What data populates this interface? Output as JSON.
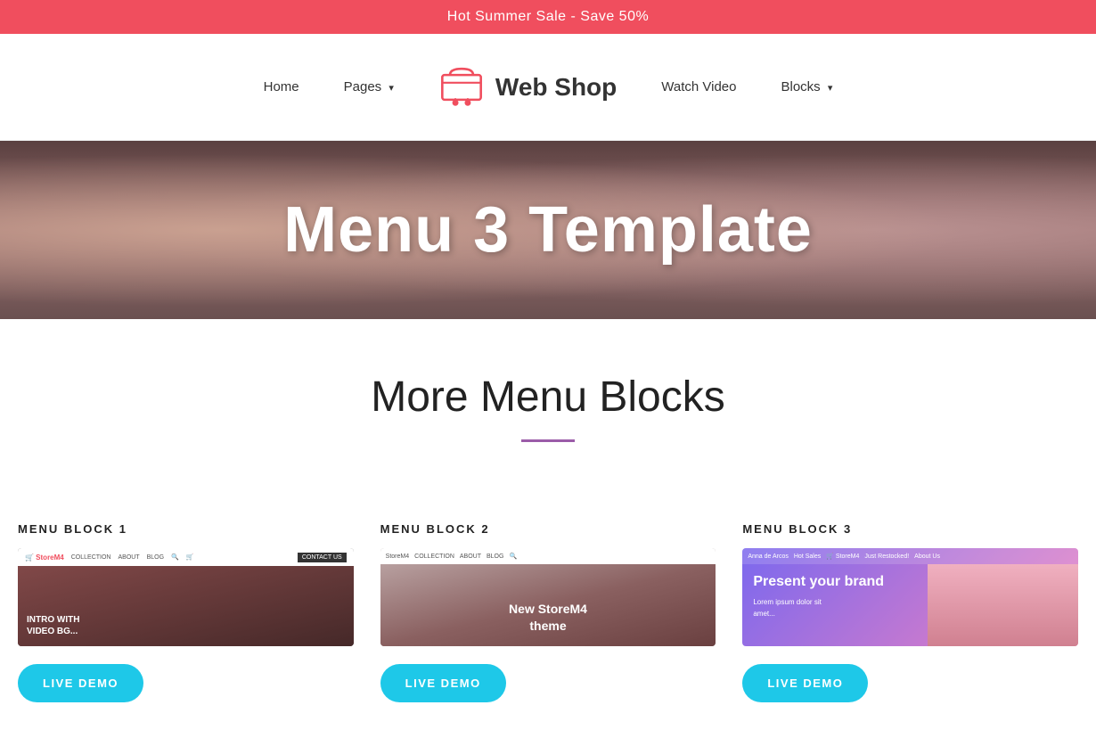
{
  "topBanner": {
    "text": "Hot Summer Sale - Save 50%"
  },
  "navbar": {
    "homeLabel": "Home",
    "pagesLabel": "Pages",
    "brandName": "Web Shop",
    "watchVideoLabel": "Watch Video",
    "blocksLabel": "Blocks"
  },
  "hero": {
    "title": "Menu 3 Template"
  },
  "moreMenuBlocks": {
    "sectionTitle": "More Menu Blocks",
    "cards": [
      {
        "label": "MENU BLOCK 1",
        "overlayLine1": "INTRO WITH",
        "overlayLine2": "VIDEO BG...",
        "btnLabel": "LIVE DEMO"
      },
      {
        "label": "MENU BLOCK 2",
        "overlayLine1": "New StoreM4",
        "overlayLine2": "theme",
        "btnLabel": "LIVE DEMO"
      },
      {
        "label": "MENU BLOCK 3",
        "brandText": "Present your brand",
        "btnLabel": "LIVE DEMO"
      }
    ],
    "mockNav": {
      "logo": "StoreM4",
      "links": [
        "COLLECTION",
        "ABOUT",
        "BLOG"
      ]
    }
  }
}
